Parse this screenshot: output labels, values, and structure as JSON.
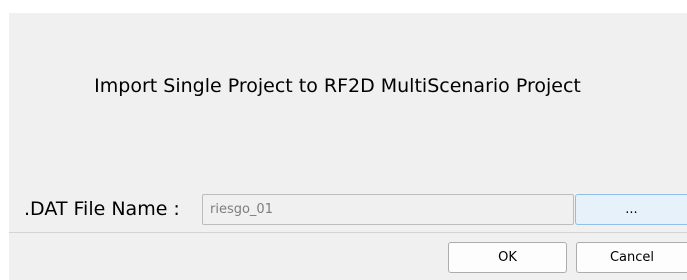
{
  "dialog": {
    "title": "Import Single Project to RF2D MultiScenario Project",
    "file_label": ".DAT File Name :",
    "file_value": "riesgo_01",
    "browse_label": "...",
    "ok_label": "OK",
    "cancel_label": "Cancel"
  }
}
